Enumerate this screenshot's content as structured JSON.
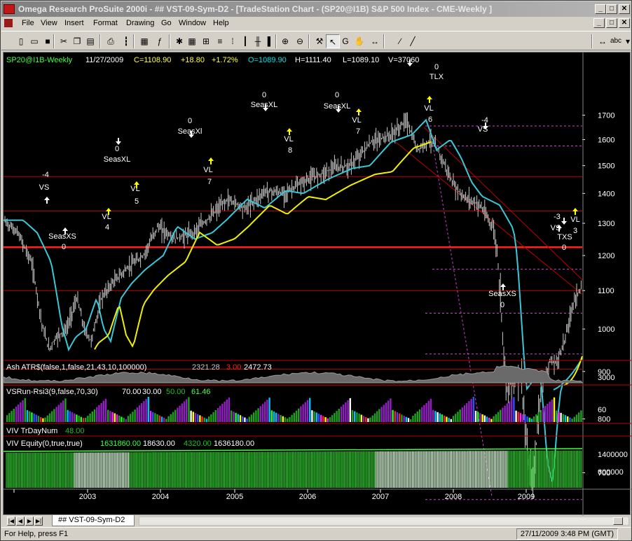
{
  "window": {
    "title": "Omega Research ProSuite 2000i - ## VST-09-Sym-D2 - [TradeStation Chart - (SP20@I1B) S&P 500 Index - CME-Weekly ]",
    "min_glyph": "_",
    "max_glyph": "□",
    "close_glyph": "✕"
  },
  "menu": [
    "File",
    "View",
    "Insert",
    "Format",
    "Drawing",
    "Go",
    "Window",
    "Help"
  ],
  "toolbar": {
    "buttons": [
      {
        "name": "new-icon",
        "glyph": "▯"
      },
      {
        "name": "open-icon",
        "glyph": "▭"
      },
      {
        "name": "save-icon",
        "glyph": "■"
      },
      {
        "name": "cut-icon",
        "glyph": "✂"
      },
      {
        "name": "copy-icon",
        "glyph": "❐"
      },
      {
        "name": "paste-icon",
        "glyph": "▤"
      },
      {
        "name": "print-icon",
        "glyph": "⎙"
      },
      {
        "name": "bar-chart-icon",
        "glyph": "┇"
      },
      {
        "name": "stats-icon",
        "glyph": "▦"
      },
      {
        "name": "insert-indicator-icon",
        "glyph": "ƒ"
      },
      {
        "name": "strategy-icon",
        "glyph": "✱"
      },
      {
        "name": "grid-icon",
        "glyph": "▦"
      },
      {
        "name": "scale-icon",
        "glyph": "⊞"
      },
      {
        "name": "hbars-icon",
        "glyph": "≡"
      },
      {
        "name": "dotbars-icon",
        "glyph": "⁞"
      },
      {
        "name": "bars-icon",
        "glyph": "┃"
      },
      {
        "name": "ohlc-icon",
        "glyph": "╫"
      },
      {
        "name": "candles-icon",
        "glyph": "▌"
      },
      {
        "name": "zoom-in-icon",
        "glyph": "⊕"
      },
      {
        "name": "zoom-out-icon",
        "glyph": "⊖"
      },
      {
        "name": "drawing-tools-icon",
        "glyph": "⚒"
      },
      {
        "name": "pointer-icon",
        "glyph": "↖"
      },
      {
        "name": "cursor-g-icon",
        "glyph": "G"
      },
      {
        "name": "hand-icon",
        "glyph": "✋"
      },
      {
        "name": "horizontal-arrow-icon",
        "glyph": "↔"
      },
      {
        "name": "pen-icon",
        "glyph": "∕"
      },
      {
        "name": "text-tool-icon",
        "glyph": "╱"
      },
      {
        "name": "arrow-both-icon",
        "glyph": "↔"
      },
      {
        "name": "text-abc-icon",
        "glyph": "abc"
      },
      {
        "name": "extra-icon",
        "glyph": "▾"
      }
    ]
  },
  "chart": {
    "symbol": "SP20@I1B-Weekly",
    "date": "11/27/2009",
    "close": "C=1108.90",
    "change": "+18.80",
    "change_pct": "+1.72%",
    "open": "O=1089.90",
    "high": "H=1111.40",
    "low": "L=1089.10",
    "volume": "V=37060",
    "price_ticks": [
      "1700",
      "1600",
      "1500",
      "1400",
      "1300",
      "1200",
      "1100",
      "1000",
      "900",
      "800",
      "700"
    ],
    "year_labels": [
      "2003",
      "2004",
      "2005",
      "2006",
      "2007",
      "2008",
      "2009"
    ],
    "annotations": [
      {
        "text": "-4"
      },
      {
        "text": "VS"
      },
      {
        "text": "SeasXS"
      },
      {
        "text": "0"
      },
      {
        "text": "0"
      },
      {
        "text": "SeasXL"
      },
      {
        "text": "VL"
      },
      {
        "text": "4"
      },
      {
        "text": "VL"
      },
      {
        "text": "5"
      },
      {
        "text": "0"
      },
      {
        "text": "SeasXl"
      },
      {
        "text": "VL"
      },
      {
        "text": "7"
      },
      {
        "text": "0"
      },
      {
        "text": "SeasXL"
      },
      {
        "text": "VL"
      },
      {
        "text": "8"
      },
      {
        "text": "0"
      },
      {
        "text": "SeasXL"
      },
      {
        "text": "VL"
      },
      {
        "text": "7"
      },
      {
        "text": "0"
      },
      {
        "text": "TLX"
      },
      {
        "text": "VL"
      },
      {
        "text": "6"
      },
      {
        "text": "-4"
      },
      {
        "text": "VS"
      },
      {
        "text": "SeasXS"
      },
      {
        "text": "0"
      },
      {
        "text": "-3"
      },
      {
        "text": "VS"
      },
      {
        "text": "TXS"
      },
      {
        "text": "0"
      },
      {
        "text": "VL"
      },
      {
        "text": "3"
      }
    ],
    "colors": {
      "price_bars": "#c8c8c8",
      "ma_cyan": "#39c8d8",
      "ma_yellow": "#f0f000",
      "support_red": "#ff2020",
      "hlines": "#c00000",
      "fib_magenta": "#d040d0",
      "close_yellow": "#ffff40",
      "positive": "#40ff40"
    }
  },
  "panels": {
    "atr": {
      "label": "Ash ATR$(false,1,false,21,43,10,100000)",
      "v1": "2321.28",
      "v2": "3.00",
      "v3": "2472.73",
      "tick": "3000"
    },
    "rsi": {
      "label": "VSRun-Rsi3(9,false,70,30)",
      "v1": "70.00",
      "v2": "30.00",
      "v3": "50.00",
      "v4": "61.46",
      "tick": "60"
    },
    "trday": {
      "label": "VIV TrDayNum",
      "v1": "48.00"
    },
    "equity": {
      "label": "VIV Equity(0,true,true)",
      "v1": "1631860.00",
      "v2": "18630.00",
      "v3": "4320.00",
      "v4": "1636180.00",
      "ticks": [
        "1400000",
        "600000"
      ]
    }
  },
  "tabs": {
    "sheet_tab": "## VST-09-Sym-D2"
  },
  "status": {
    "message": "For Help, press F1",
    "clock": "27/11/2009 3:48 PM (GMT)"
  }
}
